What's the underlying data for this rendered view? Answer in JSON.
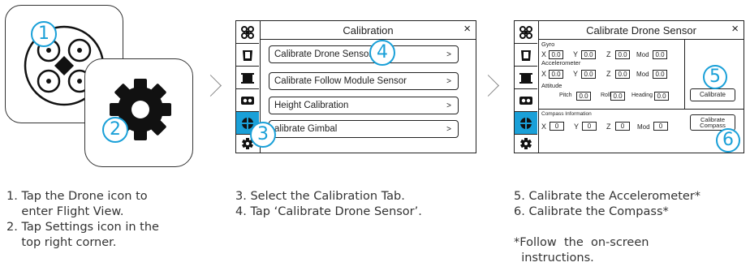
{
  "badges": {
    "b1": "1",
    "b2": "2",
    "b3": "3",
    "b4": "4",
    "b5": "5",
    "b6": "6"
  },
  "screen1": {
    "title": "Calibration",
    "close": "×",
    "items": [
      {
        "label": "Calibrate Drone Sensor",
        "arrow": ">"
      },
      {
        "label": "Calibrate Follow Module Sensor",
        "arrow": ">"
      },
      {
        "label": "Height Calibration",
        "arrow": ">"
      },
      {
        "label": "alibrate Gimbal",
        "arrow": ">"
      }
    ]
  },
  "screen2": {
    "title": "Calibrate Drone Sensor",
    "close": "×",
    "gyro_label": "Gyro",
    "accel_label": "Accelerometer",
    "attitude_label": "Attitude",
    "compass_label": "Compass Information",
    "axis": {
      "x": "X",
      "y": "Y",
      "z": "Z",
      "mod": "Mod"
    },
    "gyro": {
      "x": "0.0",
      "y": "0.0",
      "z": "0.0",
      "mod": "0.0"
    },
    "accel": {
      "x": "0.0",
      "y": "0.0",
      "z": "0.0",
      "mod": "0.0"
    },
    "attitude": {
      "pitch_label": "Pitch",
      "pitch": "0.0",
      "roll_label": "Roll",
      "roll": "0.0",
      "heading_label": "Heading",
      "heading": "0.0"
    },
    "compass": {
      "x": "0",
      "y": "0",
      "z": "0",
      "mod": "0"
    },
    "calibrate_button": "Calibrate",
    "calibrate_compass_button": "Calibrate Compass"
  },
  "captions": {
    "col1": "1. Tap the Drone icon to\n    enter Flight View.\n2. Tap Settings icon in the\n    top right corner.",
    "col2": "3. Select the Calibration Tab.\n4. Tap ‘Calibrate Drone Sensor’.",
    "col3": "5. Calibrate the Accelerometer*\n6. Calibrate the Compass*\n\n*Follow  the  on-screen\n  instructions."
  },
  "colors": {
    "accent": "#1aa0d8",
    "line": "#222222"
  },
  "icons": [
    "drone-icon",
    "settings-gear-icon",
    "chevron-right-icon",
    "close-icon",
    "drone-tab-icon",
    "remote-tab-icon",
    "follow-module-tab-icon",
    "camera-tab-icon",
    "calibration-tab-icon",
    "settings-tab-icon"
  ]
}
